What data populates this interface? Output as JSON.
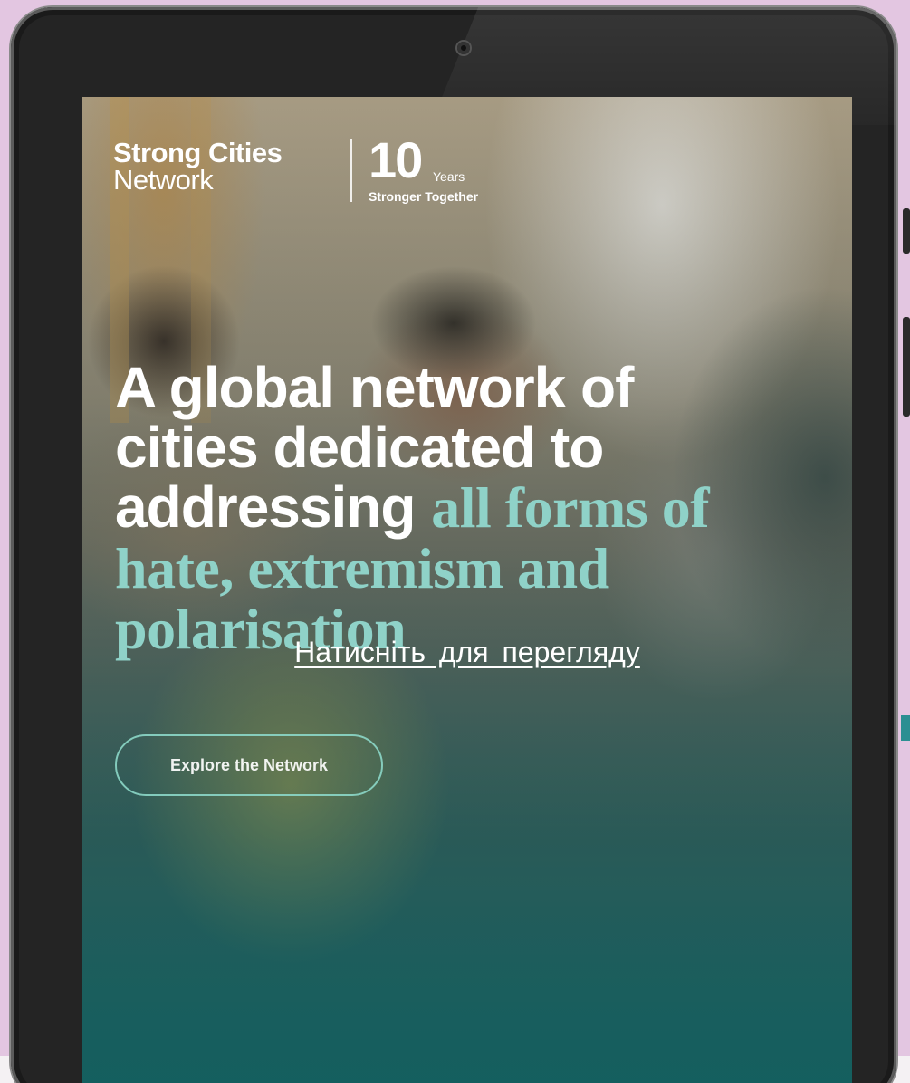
{
  "page": {
    "background_color": "#e3c6e1"
  },
  "site": {
    "logo_line1": "Strong Cities",
    "logo_line2": "Network",
    "badge_number": "10",
    "badge_years": "Years",
    "badge_tagline": "Stronger Together"
  },
  "hero": {
    "headline_white_1": "A global network of",
    "headline_white_2": "cities dedicated to",
    "headline_white_3": "addressing",
    "headline_accent_1": "all forms of",
    "headline_accent_2": "hate, extremism and",
    "headline_accent_3": "polarisation",
    "accent_color": "#8fd2c8",
    "cta_label": "Explore the Network"
  },
  "overlay": {
    "view_link": "Натисніть для перегляду"
  }
}
